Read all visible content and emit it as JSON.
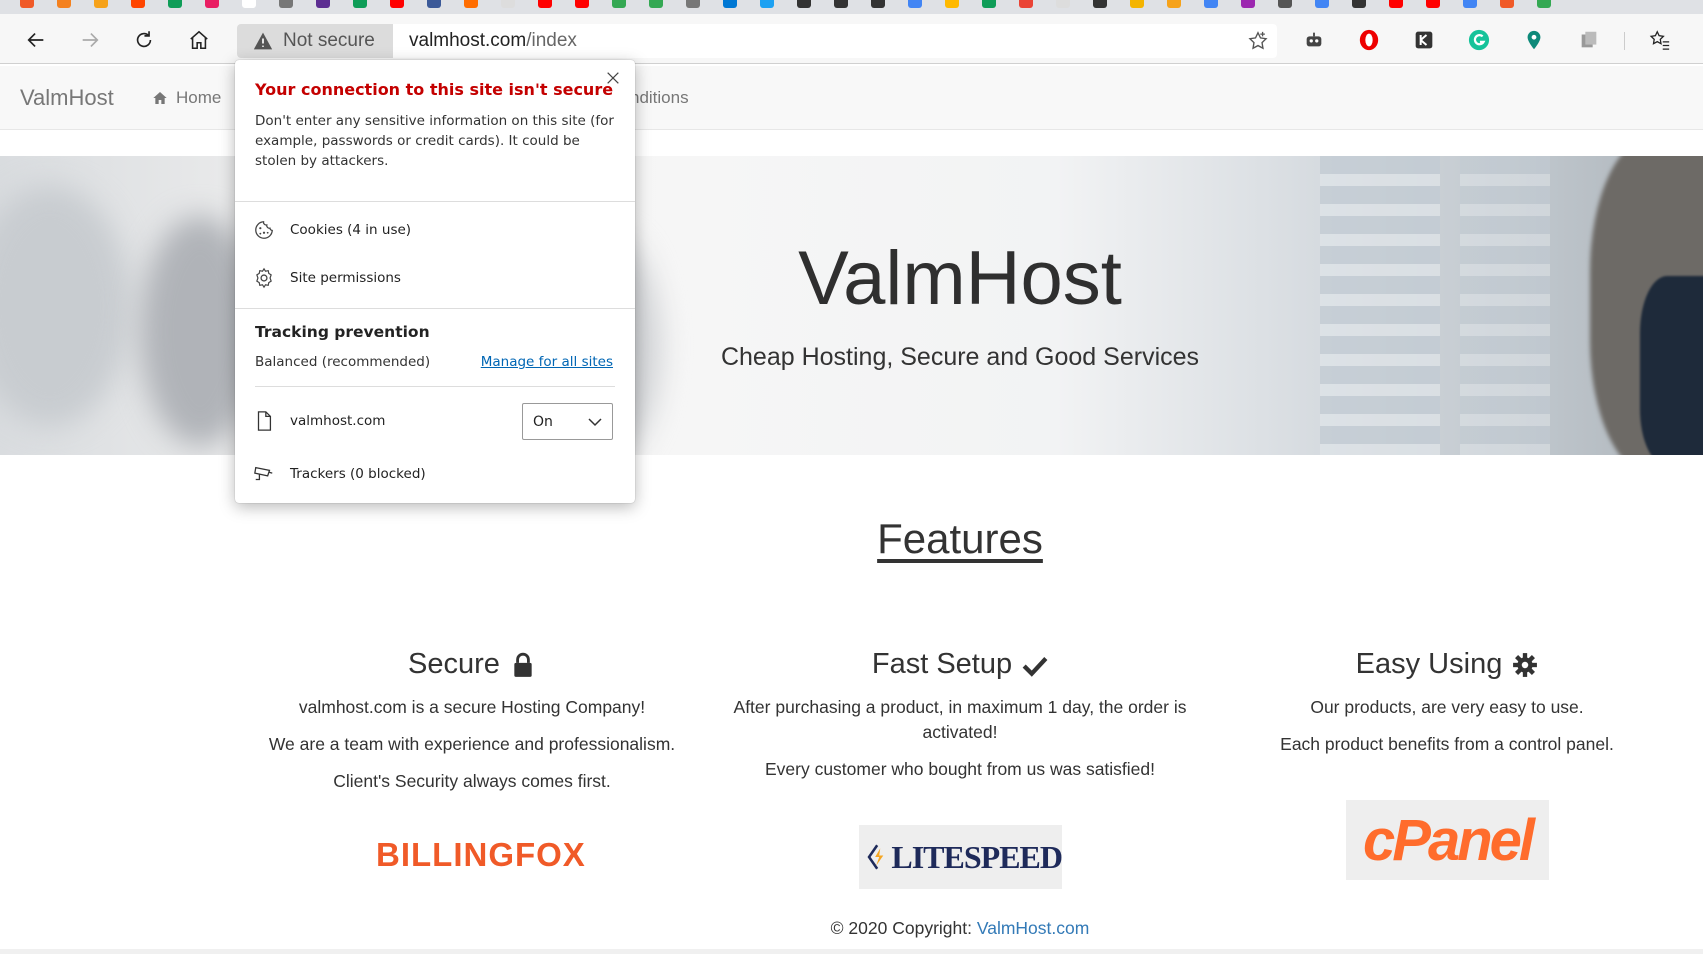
{
  "browser": {
    "security_label": "Not secure",
    "url_host": "valmhost.com",
    "url_path": "/index",
    "tab_favicon_colors": [
      "#f05a28",
      "#f4811f",
      "#f6a21a",
      "#ff4500",
      "#0f9d58",
      "#e91e63",
      "#ffffff",
      "#777777",
      "#5c2d91",
      "#0f9d58",
      "#ff0000",
      "#3b5998",
      "#ff6d00",
      "#dddddd",
      "#ff0000",
      "#ff0000",
      "#34a853",
      "#34a853",
      "#777777",
      "#0078d4",
      "#1da1f2",
      "#333333",
      "#333333",
      "#333333",
      "#4285f4",
      "#ffb900",
      "#0f9d58",
      "#ea4335",
      "#dddddd",
      "#333333",
      "#f4b400",
      "#f6a21a",
      "#4285f4",
      "#9c27b0",
      "#555555",
      "#4285f4",
      "#333333",
      "#ff0000",
      "#ff0000",
      "#4285f4",
      "#f05a28",
      "#34a853"
    ],
    "extensions": [
      "robot-icon",
      "opera-icon",
      "kaspersky-icon",
      "grammarly-icon",
      "map-pin-icon",
      "stack-icon",
      "favorites-icon"
    ]
  },
  "site": {
    "brand": "ValmHost",
    "nav": {
      "home": "Home",
      "conditions": "nditions"
    },
    "hero": {
      "title": "ValmHost",
      "subtitle": "Cheap Hosting, Secure and Good Services"
    },
    "features_title": "Features",
    "features": [
      {
        "title": "Secure",
        "icon": "lock-icon",
        "lines": [
          "valmhost.com is a secure Hosting Company!",
          "We are a team with experience and professionalism.",
          "Client's Security always comes first."
        ]
      },
      {
        "title": "Fast Setup",
        "icon": "checkmark-icon",
        "lines": [
          "After purchasing a product, in maximum 1 day, the order is activated!",
          "Every customer who bought from us was satisfied!"
        ]
      },
      {
        "title": "Easy Using",
        "icon": "gear-icon",
        "lines": [
          "Our products, are very easy to use.",
          "Each product benefits from a control panel."
        ]
      }
    ],
    "logos": {
      "billingfox": "BILLINGFOX",
      "litespeed": "LITESPEED",
      "cpanel": "cPanel"
    },
    "footer": {
      "text": "© 2020 Copyright: ",
      "link": "ValmHost.com"
    }
  },
  "popup": {
    "title": "Your connection to this site isn't secure",
    "description": "Don't enter any sensitive information on this site (for example, passwords or credit cards). It could be stolen by attackers.",
    "cookies": "Cookies (4 in use)",
    "permissions": "Site permissions",
    "tracking_title": "Tracking prevention",
    "tracking_level": "Balanced (recommended)",
    "manage_link": "Manage for all sites",
    "site_name": "valmhost.com",
    "site_toggle_value": "On",
    "trackers": "Trackers (0 blocked)"
  },
  "colors": {
    "not_secure_red": "#c40000",
    "link_blue": "#0066b4",
    "footer_link": "#337ab7"
  }
}
